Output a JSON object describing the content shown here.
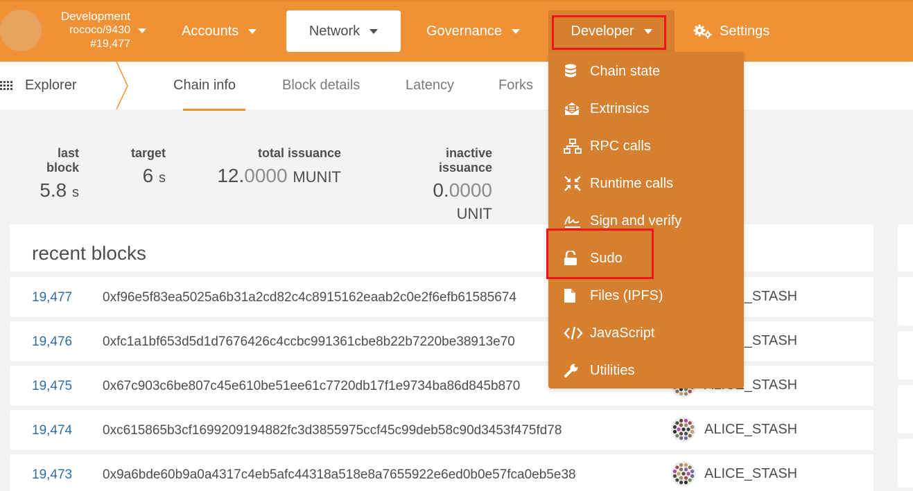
{
  "chain": {
    "name": "Development",
    "network": "rococo/9430",
    "block": "#19,477"
  },
  "nav": {
    "accounts": "Accounts",
    "network": "Network",
    "governance": "Governance",
    "developer": "Developer",
    "settings": "Settings"
  },
  "subnav": {
    "explorer": "Explorer",
    "tabs": [
      "Chain info",
      "Block details",
      "Latency",
      "Forks"
    ]
  },
  "summary": {
    "last_block": {
      "label": "last block",
      "value": "5.8",
      "unit": "s"
    },
    "target": {
      "label": "target",
      "value": "6",
      "unit": "s"
    },
    "total_issuance": {
      "label": "total issuance",
      "int": "12.",
      "frac": "0000",
      "unit": "MUNIT"
    },
    "inactive_issuance": {
      "label": "inactive issuance",
      "int": "0.",
      "frac": "0000",
      "unit": "UNIT"
    }
  },
  "recent_blocks": {
    "title": "recent blocks",
    "rows": [
      {
        "number": "19,477",
        "hash": "0xf96e5f83ea5025a6b31a2cd82c4c8915162eaab2c0e2f6efb61585674",
        "author": "ALICE_STASH"
      },
      {
        "number": "19,476",
        "hash": "0xfc1a1bf653d5d1d7676426c4ccbc991361cbe8b22b7220be38913e70",
        "author": "ALICE_STASH"
      },
      {
        "number": "19,475",
        "hash": "0x67c903c6be807c45e610be51ee61c7720db17f1e9734ba86d845b870",
        "author": "ALICE_STASH"
      },
      {
        "number": "19,474",
        "hash": "0xc615865b3cf1699209194882fc3d3855975ccf45c99deb58c90d3453f475fd78",
        "author": "ALICE_STASH"
      },
      {
        "number": "19,473",
        "hash": "0x9a6bde60b9a0a4317c4eb5afc44318a518e8a7655922e6ed0b0e57fca0eb5e38",
        "author": "ALICE_STASH"
      }
    ]
  },
  "developer_menu": {
    "items": [
      {
        "label": "Chain state",
        "icon": "database-icon"
      },
      {
        "label": "Extrinsics",
        "icon": "envelope-open-icon"
      },
      {
        "label": "RPC calls",
        "icon": "network-wired-icon"
      },
      {
        "label": "Runtime calls",
        "icon": "compress-arrows-icon"
      },
      {
        "label": "Sign and verify",
        "icon": "signature-icon"
      },
      {
        "label": "Sudo",
        "icon": "unlock-icon"
      },
      {
        "label": "Files (IPFS)",
        "icon": "file-icon"
      },
      {
        "label": "JavaScript",
        "icon": "code-icon"
      },
      {
        "label": "Utilities",
        "icon": "wrench-icon"
      }
    ]
  },
  "colors": {
    "topbar": "#f19135",
    "dropdown": "#d67f2e",
    "highlight_box": "#f0141e",
    "link": "#2b6fa8"
  }
}
